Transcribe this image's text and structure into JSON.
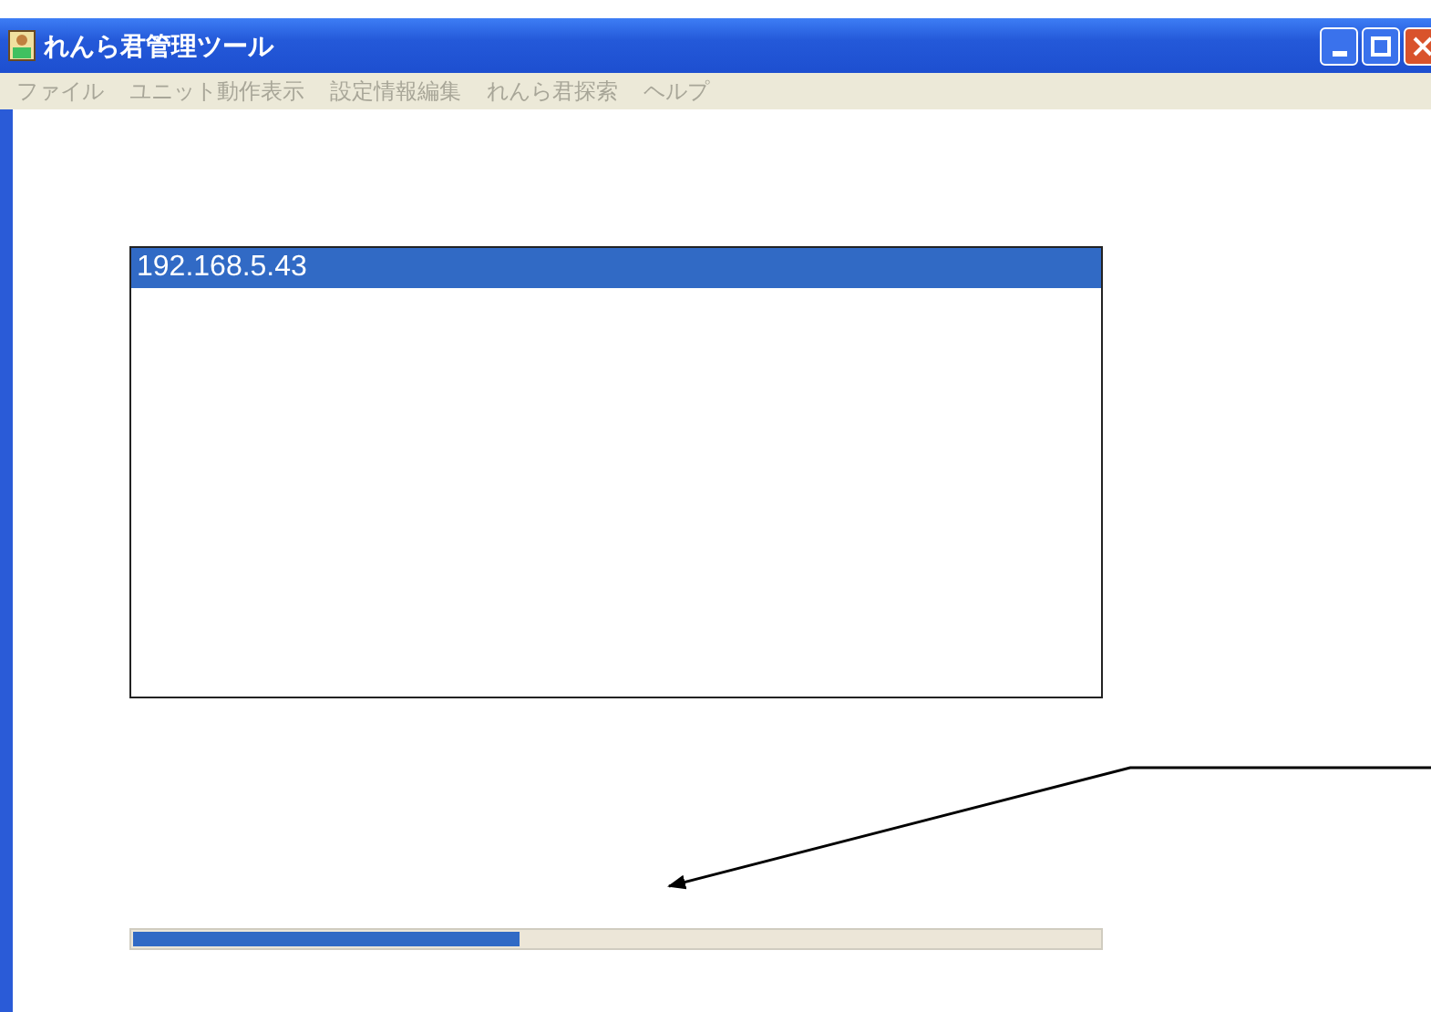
{
  "window": {
    "title": "れんら君管理ツール"
  },
  "menu": [
    {
      "label": "ファイル",
      "disabled": true
    },
    {
      "label": "ユニット動作表示",
      "disabled": true
    },
    {
      "label": "設定情報編集",
      "disabled": true
    },
    {
      "label": "れんら君探索",
      "disabled": true
    },
    {
      "label": "ヘルプ",
      "disabled": true
    }
  ],
  "list": {
    "items": [
      {
        "label": "192.168.5.43",
        "selected": true
      }
    ]
  },
  "progress": {
    "level": 0.4
  }
}
